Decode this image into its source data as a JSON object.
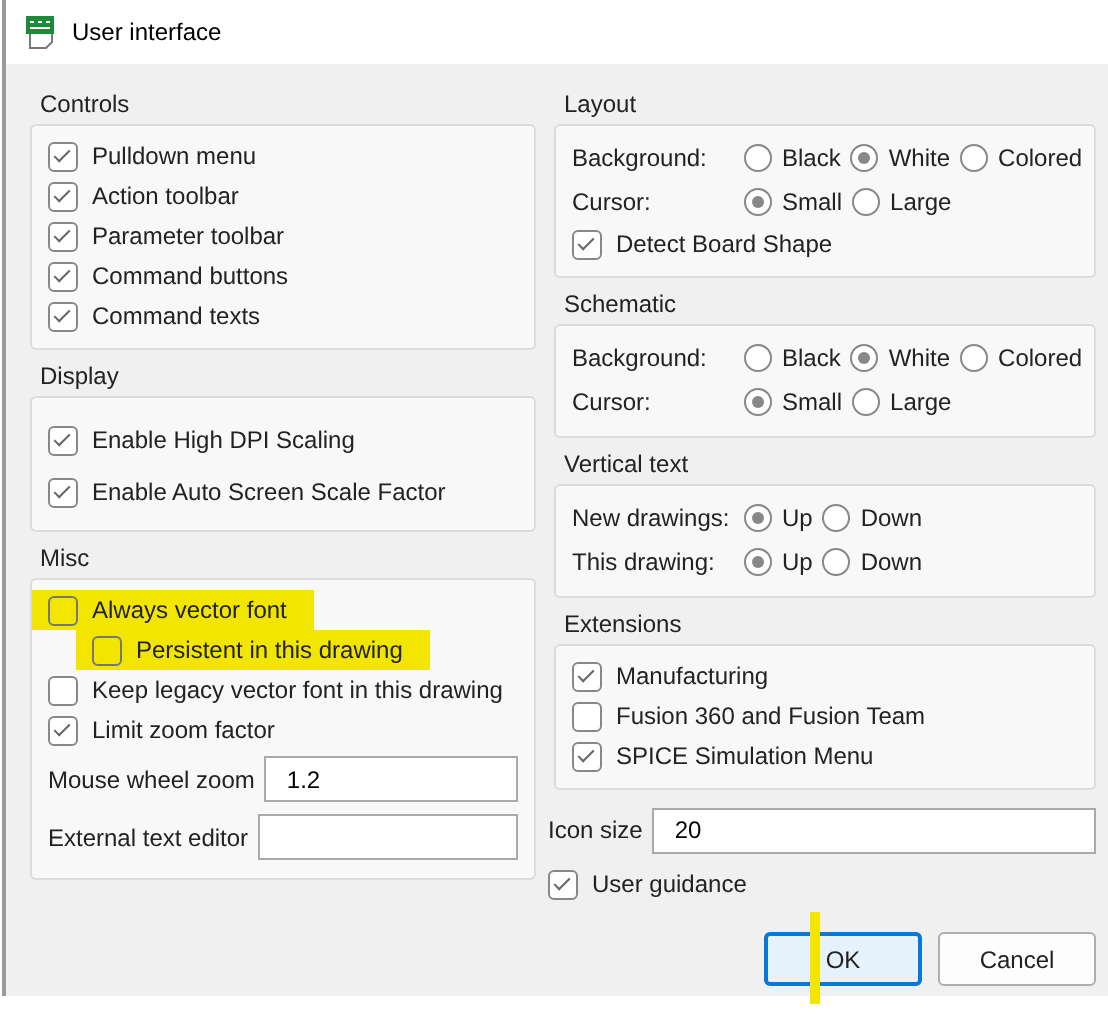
{
  "window": {
    "title": "User interface"
  },
  "left_sections": [
    {
      "title": "Controls",
      "items": [
        {
          "kind": "checkbox",
          "label": "Pulldown menu",
          "checked": true,
          "highlighted": false
        },
        {
          "kind": "checkbox",
          "label": "Action toolbar",
          "checked": true,
          "highlighted": false
        },
        {
          "kind": "checkbox",
          "label": "Parameter toolbar",
          "checked": true,
          "highlighted": false
        },
        {
          "kind": "checkbox",
          "label": "Command buttons",
          "checked": true,
          "highlighted": false
        },
        {
          "kind": "checkbox",
          "label": "Command texts",
          "checked": true,
          "highlighted": false
        }
      ]
    },
    {
      "title": "Display",
      "items": [
        {
          "kind": "checkbox",
          "label": "Enable High DPI Scaling",
          "checked": true,
          "highlighted": false
        },
        {
          "kind": "checkbox",
          "label": "Enable Auto Screen Scale Factor",
          "checked": true,
          "highlighted": false
        }
      ]
    },
    {
      "title": "Misc",
      "items": [
        {
          "kind": "checkbox",
          "label": "Always vector font",
          "checked": false,
          "highlighted": true,
          "children": [
            {
              "kind": "checkbox",
              "label": "Persistent in this drawing",
              "checked": false,
              "highlighted": true
            }
          ]
        },
        {
          "kind": "checkbox",
          "label": "Keep legacy vector font in this drawing",
          "checked": false,
          "highlighted": false
        },
        {
          "kind": "checkbox",
          "label": "Limit zoom factor",
          "checked": true,
          "highlighted": false
        },
        {
          "kind": "field",
          "label": "Mouse wheel zoom",
          "value": "1.2"
        },
        {
          "kind": "field",
          "label": "External text editor",
          "value": ""
        }
      ]
    }
  ],
  "right_sections": [
    {
      "title": "Layout",
      "items": [
        {
          "kind": "radio_group",
          "label": "Background:",
          "options": [
            {
              "label": "Black",
              "selected": false
            },
            {
              "label": "White",
              "selected": true
            },
            {
              "label": "Colored",
              "selected": false
            }
          ]
        },
        {
          "kind": "radio_group",
          "label": "Cursor:",
          "options": [
            {
              "label": "Small",
              "selected": true
            },
            {
              "label": "Large",
              "selected": false
            }
          ]
        },
        {
          "kind": "checkbox",
          "label": "Detect Board Shape",
          "checked": true,
          "highlighted": false
        }
      ]
    },
    {
      "title": "Schematic",
      "items": [
        {
          "kind": "radio_group",
          "label": "Background:",
          "options": [
            {
              "label": "Black",
              "selected": false
            },
            {
              "label": "White",
              "selected": true
            },
            {
              "label": "Colored",
              "selected": false
            }
          ]
        },
        {
          "kind": "radio_group",
          "label": "Cursor:",
          "options": [
            {
              "label": "Small",
              "selected": true
            },
            {
              "label": "Large",
              "selected": false
            }
          ]
        }
      ]
    },
    {
      "title": "Vertical text",
      "items": [
        {
          "kind": "radio_group",
          "label": "New drawings:",
          "options": [
            {
              "label": "Up",
              "selected": true
            },
            {
              "label": "Down",
              "selected": false
            }
          ]
        },
        {
          "kind": "radio_group",
          "label": "This drawing:",
          "options": [
            {
              "label": "Up",
              "selected": true
            },
            {
              "label": "Down",
              "selected": false
            }
          ]
        }
      ]
    },
    {
      "title": "Extensions",
      "items": [
        {
          "kind": "checkbox",
          "label": "Manufacturing",
          "checked": true,
          "highlighted": false
        },
        {
          "kind": "checkbox",
          "label": "Fusion 360 and Fusion Team",
          "checked": false,
          "highlighted": false
        },
        {
          "kind": "checkbox",
          "label": "SPICE Simulation Menu",
          "checked": true,
          "highlighted": false
        }
      ]
    }
  ],
  "right_extras": [
    {
      "kind": "field",
      "label": "Icon size",
      "value": "20"
    },
    {
      "kind": "checkbox",
      "label": "User guidance",
      "checked": true,
      "highlighted": false
    }
  ],
  "buttons": [
    {
      "label": "OK",
      "default": true,
      "highlighted": true
    },
    {
      "label": "Cancel",
      "default": false,
      "highlighted": false
    }
  ]
}
